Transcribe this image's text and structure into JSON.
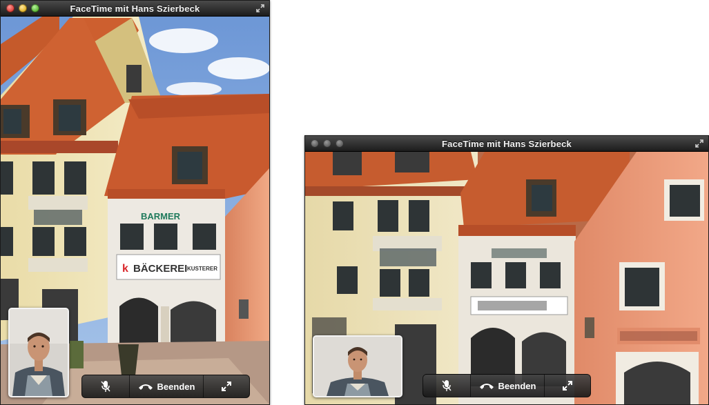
{
  "window_left": {
    "title": "FaceTime mit Hans Szierbeck",
    "controls": {
      "end_label": "Beenden",
      "mute_icon": "mic-muted-icon",
      "fullscreen_icon": "fullscreen-icon",
      "end_icon": "phone-icon"
    },
    "storefront": {
      "shop_sign": "BÄCKEREI",
      "shop_sign_right": "KUSTERER",
      "bank_sign": "BARMER"
    }
  },
  "window_right": {
    "title": "FaceTime mit Hans Szierbeck",
    "controls": {
      "end_label": "Beenden",
      "mute_icon": "mic-muted-icon",
      "fullscreen_icon": "fullscreen-icon",
      "end_icon": "phone-icon"
    }
  },
  "colors": {
    "titlebar": "#2a2a2a",
    "roof": "#cc5b2d",
    "wall_pink": "#e89a7a",
    "wall_cream": "#efe3b8",
    "sky": "#8fb3e3"
  }
}
